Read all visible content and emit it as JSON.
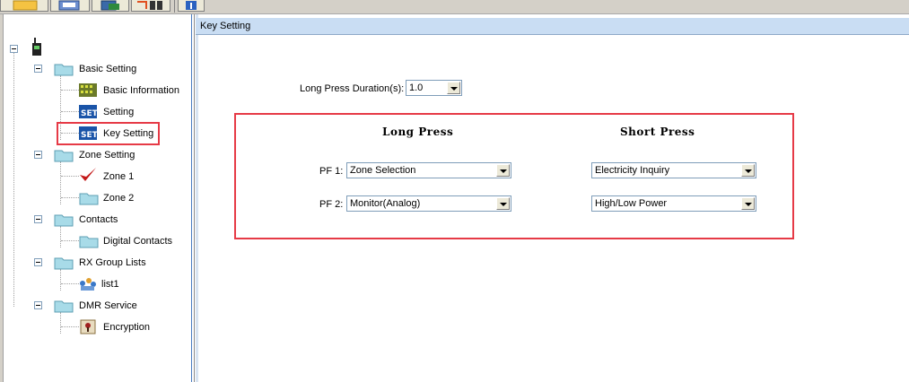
{
  "toolbar": {
    "buttons": [
      {
        "icon": "open-folder-icon"
      },
      {
        "icon": "save-icon"
      },
      {
        "icon": "read-radio-icon"
      },
      {
        "icon": "write-radio-icon"
      },
      {
        "icon": "about-icon"
      }
    ]
  },
  "tree": {
    "root_icon": "radio-icon",
    "items": [
      {
        "label": "Basic Setting",
        "icon": "folder-icon"
      },
      {
        "label": "Basic Information",
        "icon": "basic-info-icon"
      },
      {
        "label": "Setting",
        "icon": "set-icon"
      },
      {
        "label": "Key Setting",
        "icon": "set-icon"
      },
      {
        "label": "Zone Setting",
        "icon": "folder-icon"
      },
      {
        "label": "Zone 1",
        "icon": "checkmark-icon"
      },
      {
        "label": "Zone 2",
        "icon": "folder-icon"
      },
      {
        "label": "Contacts",
        "icon": "folder-icon"
      },
      {
        "label": "Digital Contacts",
        "icon": "folder-icon"
      },
      {
        "label": "RX Group Lists",
        "icon": "folder-icon"
      },
      {
        "label": "list1",
        "icon": "group-icon"
      },
      {
        "label": "DMR Service",
        "icon": "folder-icon"
      },
      {
        "label": "Encryption",
        "icon": "encryption-icon"
      }
    ],
    "selected": "Key Setting"
  },
  "main": {
    "title": "Key Setting",
    "long_press_duration": {
      "label": "Long Press Duration(s):",
      "value": "1.0"
    },
    "columns": {
      "long": "Long Press",
      "short": "Short Press"
    },
    "rows": [
      {
        "label": "PF 1:",
        "long": "Zone Selection",
        "short": "Electricity Inquiry"
      },
      {
        "label": "PF 2:",
        "long": "Monitor(Analog)",
        "short": "High/Low Power"
      }
    ]
  },
  "colors": {
    "highlight": "#e63a46",
    "header": "#c9ddf3"
  }
}
